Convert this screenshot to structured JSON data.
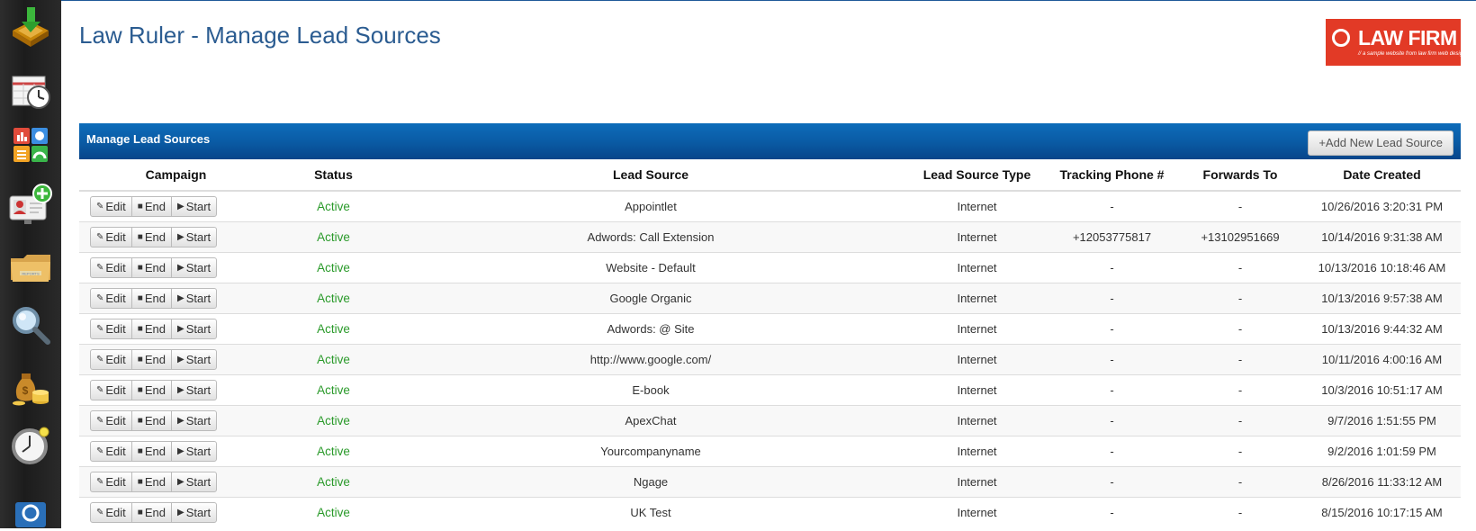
{
  "page": {
    "title": "Law Ruler - Manage Lead Sources"
  },
  "sidebar": {
    "icons": [
      "inbox-download-icon",
      "calendar-clock-icon",
      "dashboard-apps-icon",
      "add-contact-icon",
      "reports-folder-icon",
      "search-icon",
      "money-bags-icon",
      "clock-icon",
      "email-icon"
    ]
  },
  "logo": {
    "name": "LAW FIRM",
    "tagline": "// a sample website from law firm web design"
  },
  "panel": {
    "title": "Manage Lead Sources",
    "add_button": "+Add New Lead Source"
  },
  "buttons": {
    "edit": "Edit",
    "end": "End",
    "start": "Start"
  },
  "table": {
    "headers": {
      "campaign": "Campaign",
      "status": "Status",
      "lead_source": "Lead Source",
      "type": "Lead Source Type",
      "tracking": "Tracking Phone #",
      "forwards": "Forwards To",
      "date": "Date Created"
    },
    "rows": [
      {
        "status": "Active",
        "lead_source": "Appointlet",
        "type": "Internet",
        "tracking": "-",
        "forwards": "-",
        "date": "10/26/2016 3:20:31 PM"
      },
      {
        "status": "Active",
        "lead_source": "Adwords: Call Extension",
        "type": "Internet",
        "tracking": "+12053775817",
        "forwards": "+13102951669",
        "date": "10/14/2016 9:31:38 AM"
      },
      {
        "status": "Active",
        "lead_source": "Website - Default",
        "type": "Internet",
        "tracking": "-",
        "forwards": "-",
        "date": "10/13/2016 10:18:46 AM"
      },
      {
        "status": "Active",
        "lead_source": "Google Organic",
        "type": "Internet",
        "tracking": "-",
        "forwards": "-",
        "date": "10/13/2016 9:57:38 AM"
      },
      {
        "status": "Active",
        "lead_source": "Adwords: @ Site",
        "type": "Internet",
        "tracking": "-",
        "forwards": "-",
        "date": "10/13/2016 9:44:32 AM"
      },
      {
        "status": "Active",
        "lead_source": "http://www.google.com/",
        "type": "Internet",
        "tracking": "-",
        "forwards": "-",
        "date": "10/11/2016 4:00:16 AM"
      },
      {
        "status": "Active",
        "lead_source": "E-book",
        "type": "Internet",
        "tracking": "-",
        "forwards": "-",
        "date": "10/3/2016 10:51:17 AM"
      },
      {
        "status": "Active",
        "lead_source": "ApexChat",
        "type": "Internet",
        "tracking": "-",
        "forwards": "-",
        "date": "9/7/2016 1:51:55 PM"
      },
      {
        "status": "Active",
        "lead_source": "Yourcompanyname",
        "type": "Internet",
        "tracking": "-",
        "forwards": "-",
        "date": "9/2/2016 1:01:59 PM"
      },
      {
        "status": "Active",
        "lead_source": "Ngage",
        "type": "Internet",
        "tracking": "-",
        "forwards": "-",
        "date": "8/26/2016 11:33:12 AM"
      },
      {
        "status": "Active",
        "lead_source": "UK Test",
        "type": "Internet",
        "tracking": "-",
        "forwards": "-",
        "date": "8/15/2016 10:17:15 AM"
      }
    ]
  },
  "colors": {
    "title": "#2b5c91",
    "panel": "#0a5aa3",
    "status_active": "#2a9a2a",
    "logo": "#e23a26"
  }
}
